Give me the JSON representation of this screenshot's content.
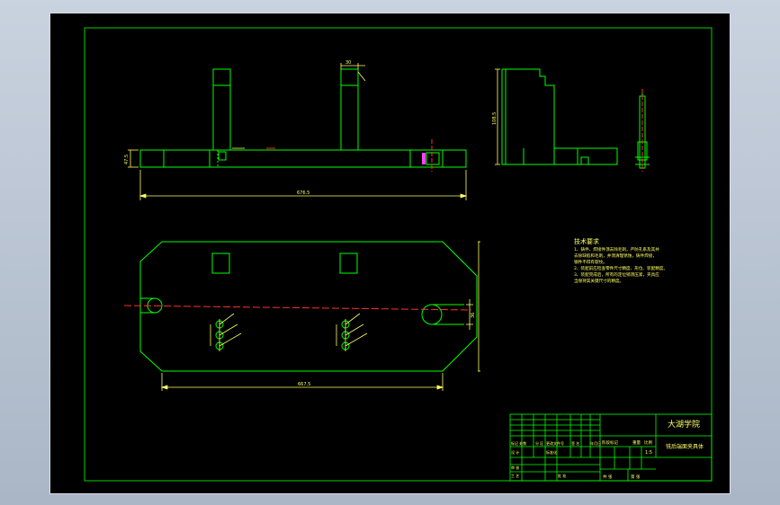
{
  "colors": {
    "background": "#000000",
    "frame": "#00d400",
    "line": "#00ff00",
    "dim": "#ffff66",
    "red": "#ff3030",
    "text": "#ffff66",
    "magenta": "#ff40ff"
  },
  "dimensions": {
    "front_length": "676.5",
    "front_height": "47.5",
    "post_width": "30",
    "side_height": "108.5",
    "plan_length": "667.5",
    "plan_hole": "36"
  },
  "notes": {
    "title": "技术要求",
    "lines": [
      "1、铸件、焊接件须去除毛刺，严防孔系及其并",
      "去除缺陷和毛刺，并须清理锈蚀，铸件焊接，",
      "钢件不得有裂纹。",
      "2、装配前应检查零件尺寸精度、形位、装配精度。",
      "3、装配完成后，所有的定位销须压紧，夹具应",
      "当保持其关键尺寸的精度。"
    ]
  },
  "title_block": {
    "school": "大湖学院",
    "drawing_name": "铣后端面夹具体",
    "stage_label": "阶段标记",
    "weight_label": "重量",
    "scale_label": "比例",
    "scale_value": "1:5",
    "sheet_total": "共 张",
    "sheet_no": "第 张",
    "marker_label": "标记 处数",
    "division_label": "分 区",
    "change_label": "更改文件号",
    "sign_label": "签 名",
    "date_label": "年月日",
    "designer_label": "设 计",
    "standard_label": "标准化",
    "review_label": "审 核",
    "process_label": "工 艺",
    "approve_label": "批 准"
  }
}
